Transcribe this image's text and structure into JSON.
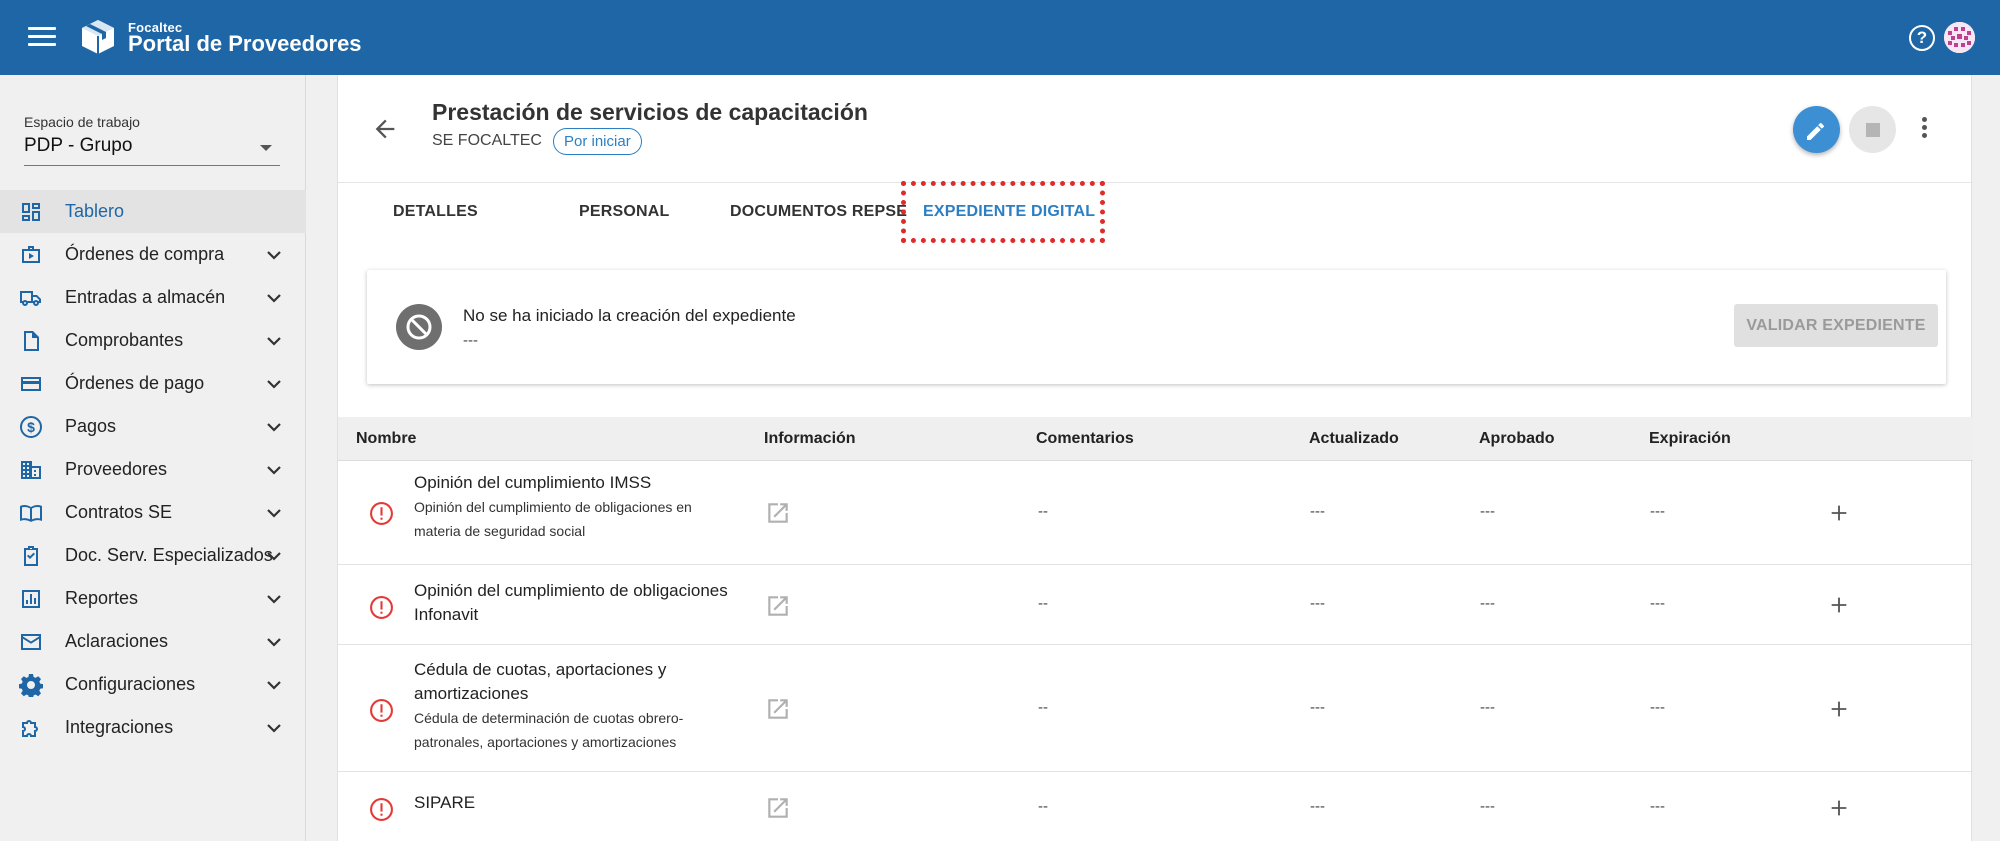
{
  "app": {
    "brand_top": "Focaltec",
    "brand_name": "Portal de Proveedores"
  },
  "sidebar": {
    "workspace_label": "Espacio de trabajo",
    "workspace_value": "PDP - Grupo",
    "items": [
      {
        "label": "Tablero",
        "icon": "dashboard-icon"
      },
      {
        "label": "Órdenes de compra",
        "icon": "purchase-order-icon"
      },
      {
        "label": "Entradas a almacén",
        "icon": "truck-icon"
      },
      {
        "label": "Comprobantes",
        "icon": "document-icon"
      },
      {
        "label": "Órdenes de pago",
        "icon": "credit-card-icon"
      },
      {
        "label": "Pagos",
        "icon": "dollar-icon"
      },
      {
        "label": "Proveedores",
        "icon": "building-icon"
      },
      {
        "label": "Contratos SE",
        "icon": "book-icon"
      },
      {
        "label": "Doc. Serv. Especializados",
        "icon": "clipboard-check-icon"
      },
      {
        "label": "Reportes",
        "icon": "bar-chart-icon"
      },
      {
        "label": "Aclaraciones",
        "icon": "mail-icon"
      },
      {
        "label": "Configuraciones",
        "icon": "gear-icon"
      },
      {
        "label": "Integraciones",
        "icon": "puzzle-icon"
      }
    ]
  },
  "header": {
    "title": "Prestación de servicios de capacitación",
    "subtitle": "SE FOCALTEC",
    "status": "Por iniciar"
  },
  "tabs": [
    {
      "label": "DETALLES"
    },
    {
      "label": "PERSONAL"
    },
    {
      "label": "DOCUMENTOS REPSE"
    },
    {
      "label": "EXPEDIENTE DIGITAL"
    }
  ],
  "status_card": {
    "title": "No se ha iniciado la creación del expediente",
    "subtitle": "---",
    "button": "VALIDAR EXPEDIENTE"
  },
  "table": {
    "columns": [
      "Nombre",
      "Información",
      "Comentarios",
      "Actualizado",
      "Aprobado",
      "Expiración"
    ],
    "rows": [
      {
        "name": "Opinión del cumplimiento IMSS",
        "desc_line1": "Opinión del cumplimiento de obligaciones en",
        "desc_line2": "materia de seguridad social",
        "comments": "--",
        "updated": "---",
        "approved": "---",
        "expiration": "---"
      },
      {
        "name_line1": "Opinión del cumplimiento de obligaciones",
        "name_line2": "Infonavit",
        "comments": "--",
        "updated": "---",
        "approved": "---",
        "expiration": "---"
      },
      {
        "name_line1": "Cédula de cuotas, aportaciones y",
        "name_line2": "amortizaciones",
        "desc_line1": "Cédula de determinación de cuotas obrero-",
        "desc_line2": "patronales, aportaciones y amortizaciones",
        "comments": "--",
        "updated": "---",
        "approved": "---",
        "expiration": "---"
      },
      {
        "name": "SIPARE",
        "comments": "--",
        "updated": "---",
        "approved": "---",
        "expiration": "---"
      }
    ]
  },
  "colors": {
    "primary": "#1e66a5",
    "accent": "#2b7fc2",
    "alert": "#e53935",
    "highlight": "#e02b2b"
  }
}
